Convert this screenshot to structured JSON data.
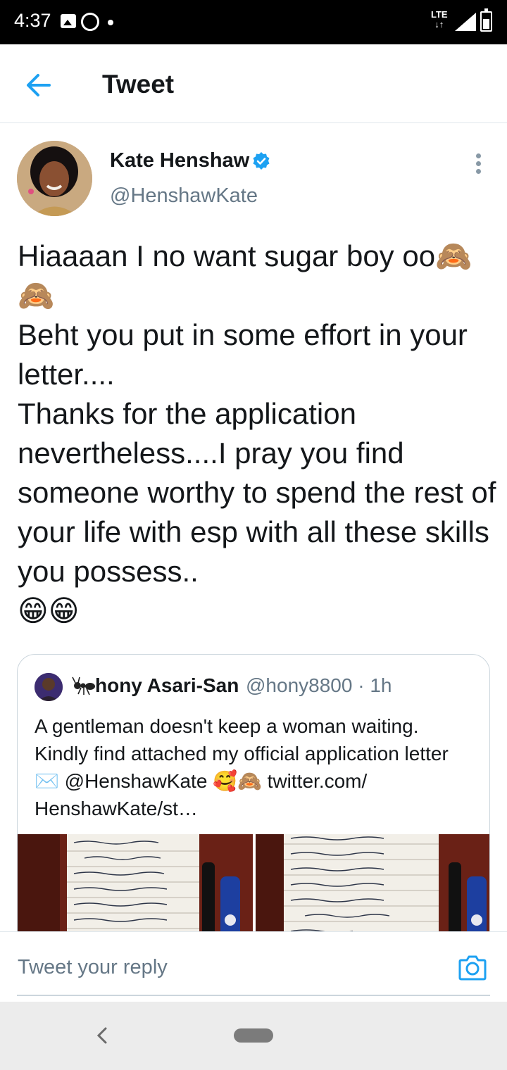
{
  "status_bar": {
    "time": "4:37",
    "network": "LTE",
    "icons": [
      "gallery-icon",
      "whatsapp-icon",
      "notification-dot-icon",
      "signal-icon",
      "battery-icon"
    ]
  },
  "app_bar": {
    "title": "Tweet",
    "back_icon": "arrow-left-icon",
    "accent_color": "#1da1f2"
  },
  "tweet": {
    "author_name": "Kate Henshaw",
    "author_handle": "@HenshawKate",
    "verified": true,
    "text": "Hiaaaan I no want sugar boy oo🙈\n🙈\nBeht you put in some effort in your letter....\nThanks for the application nevertheless....I pray you find someone worthy to spend the rest of your life with esp with all these skills you possess..\n😁😁"
  },
  "quoted_tweet": {
    "author_name": "hony Asari-San",
    "author_handle": "@hony8800 · 1h",
    "text": "A gentleman doesn't keep a woman waiting.\nKindly find attached my official application letter ✉️ @HenshawKate 🥰🙈 twitter.com/\nHenshawKate/st…",
    "images": [
      "handwritten-letter-page-1",
      "handwritten-letter-page-2"
    ]
  },
  "reply": {
    "placeholder": "Tweet your reply",
    "camera_icon": "camera-icon"
  },
  "nav_bar": {
    "back_icon": "nav-back-icon",
    "home_icon": "nav-home-pill"
  }
}
